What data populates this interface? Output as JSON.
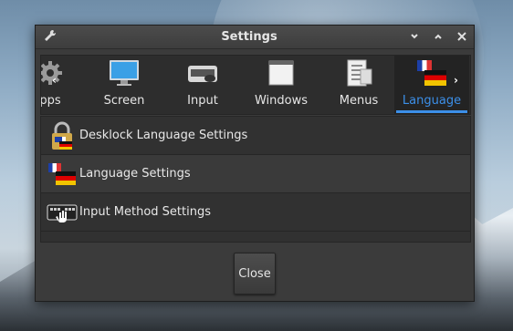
{
  "window": {
    "title": "Settings",
    "icon": "wrench-icon",
    "controls": [
      "chevron-down-icon",
      "chevron-up-icon",
      "close-icon"
    ]
  },
  "tabs": [
    {
      "label": "pps",
      "icon": "gear-icon"
    },
    {
      "label": "Screen",
      "icon": "monitor-icon"
    },
    {
      "label": "Input",
      "icon": "keyboard-mouse-icon"
    },
    {
      "label": "Windows",
      "icon": "window-icon"
    },
    {
      "label": "Menus",
      "icon": "menu-icon"
    },
    {
      "label": "Language",
      "icon": "flags-icon",
      "active": true
    }
  ],
  "items": [
    {
      "label": "Desklock Language Settings",
      "icon": "lock-flag-icon"
    },
    {
      "label": "Language Settings",
      "icon": "flags-icon"
    },
    {
      "label": "Input Method Settings",
      "icon": "keyboard-hand-icon"
    }
  ],
  "buttons": {
    "close": "Close"
  },
  "colors": {
    "accent": "#3c8fe8",
    "window_bg": "#3b3b3b",
    "row_alt": "#3a3a3a"
  }
}
